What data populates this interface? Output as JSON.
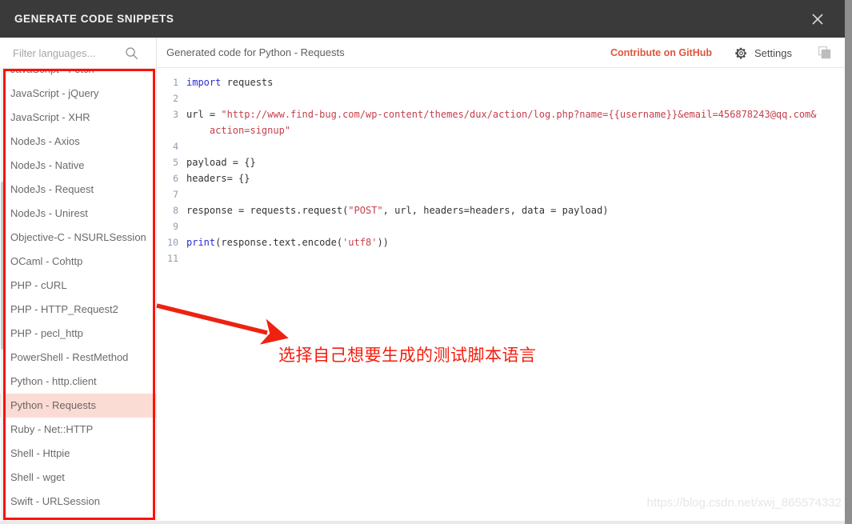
{
  "window": {
    "title": "GENERATE CODE SNIPPETS",
    "close_icon": "close-icon"
  },
  "sidebar": {
    "filter": {
      "placeholder": "Filter languages...",
      "value": "",
      "icon": "search-icon"
    },
    "languages": [
      {
        "label": "JavaScript - Fetch",
        "selected": false
      },
      {
        "label": "JavaScript - jQuery",
        "selected": false
      },
      {
        "label": "JavaScript - XHR",
        "selected": false
      },
      {
        "label": "NodeJs - Axios",
        "selected": false
      },
      {
        "label": "NodeJs - Native",
        "selected": false
      },
      {
        "label": "NodeJs - Request",
        "selected": false
      },
      {
        "label": "NodeJs - Unirest",
        "selected": false
      },
      {
        "label": "Objective-C - NSURLSession",
        "selected": false
      },
      {
        "label": "OCaml - Cohttp",
        "selected": false
      },
      {
        "label": "PHP - cURL",
        "selected": false
      },
      {
        "label": "PHP - HTTP_Request2",
        "selected": false
      },
      {
        "label": "PHP - pecl_http",
        "selected": false
      },
      {
        "label": "PowerShell - RestMethod",
        "selected": false
      },
      {
        "label": "Python - http.client",
        "selected": false
      },
      {
        "label": "Python - Requests",
        "selected": true
      },
      {
        "label": "Ruby - Net::HTTP",
        "selected": false
      },
      {
        "label": "Shell - Httpie",
        "selected": false
      },
      {
        "label": "Shell - wget",
        "selected": false
      },
      {
        "label": "Swift - URLSession",
        "selected": false
      }
    ]
  },
  "code_header": {
    "title": "Generated code for Python - Requests",
    "github_label": "Contribute on GitHub",
    "settings_label": "Settings",
    "settings_icon": "gear-icon",
    "copy_icon": "copy-icon"
  },
  "code": {
    "language": "Python - Requests",
    "lines": [
      {
        "n": "1",
        "tokens": [
          {
            "t": "import ",
            "c": "tok-kw"
          },
          {
            "t": "requests",
            "c": "tok-plain"
          }
        ]
      },
      {
        "n": "2",
        "tokens": []
      },
      {
        "n": "3",
        "tokens": [
          {
            "t": "url = ",
            "c": "tok-plain"
          },
          {
            "t": "\"http://www.find-bug.com/wp-content/themes/dux/action/log.php?name={{username}}&email=456878243@qq.com&",
            "c": "tok-str"
          }
        ]
      },
      {
        "n": "",
        "tokens": [
          {
            "t": "    action=signup\"",
            "c": "tok-str"
          }
        ]
      },
      {
        "n": "4",
        "tokens": []
      },
      {
        "n": "5",
        "tokens": [
          {
            "t": "payload = {}",
            "c": "tok-plain"
          }
        ]
      },
      {
        "n": "6",
        "tokens": [
          {
            "t": "headers= {}",
            "c": "tok-plain"
          }
        ]
      },
      {
        "n": "7",
        "tokens": []
      },
      {
        "n": "8",
        "tokens": [
          {
            "t": "response = requests.request(",
            "c": "tok-plain"
          },
          {
            "t": "\"POST\"",
            "c": "tok-str"
          },
          {
            "t": ", url, headers=headers, data = payload)",
            "c": "tok-plain"
          }
        ]
      },
      {
        "n": "9",
        "tokens": []
      },
      {
        "n": "10",
        "tokens": [
          {
            "t": "print",
            "c": "tok-fn"
          },
          {
            "t": "(response.text.encode(",
            "c": "tok-plain"
          },
          {
            "t": "'utf8'",
            "c": "tok-str"
          },
          {
            "t": "))",
            "c": "tok-plain"
          }
        ]
      },
      {
        "n": "11",
        "tokens": []
      }
    ]
  },
  "annotations": {
    "note_text": "选择自己想要生成的测试脚本语言",
    "note_color": "#f41c0c",
    "box_color": "#ff1100",
    "arrow_color": "#ee2211",
    "watermark": "https://blog.csdn.net/xwj_865574332"
  }
}
